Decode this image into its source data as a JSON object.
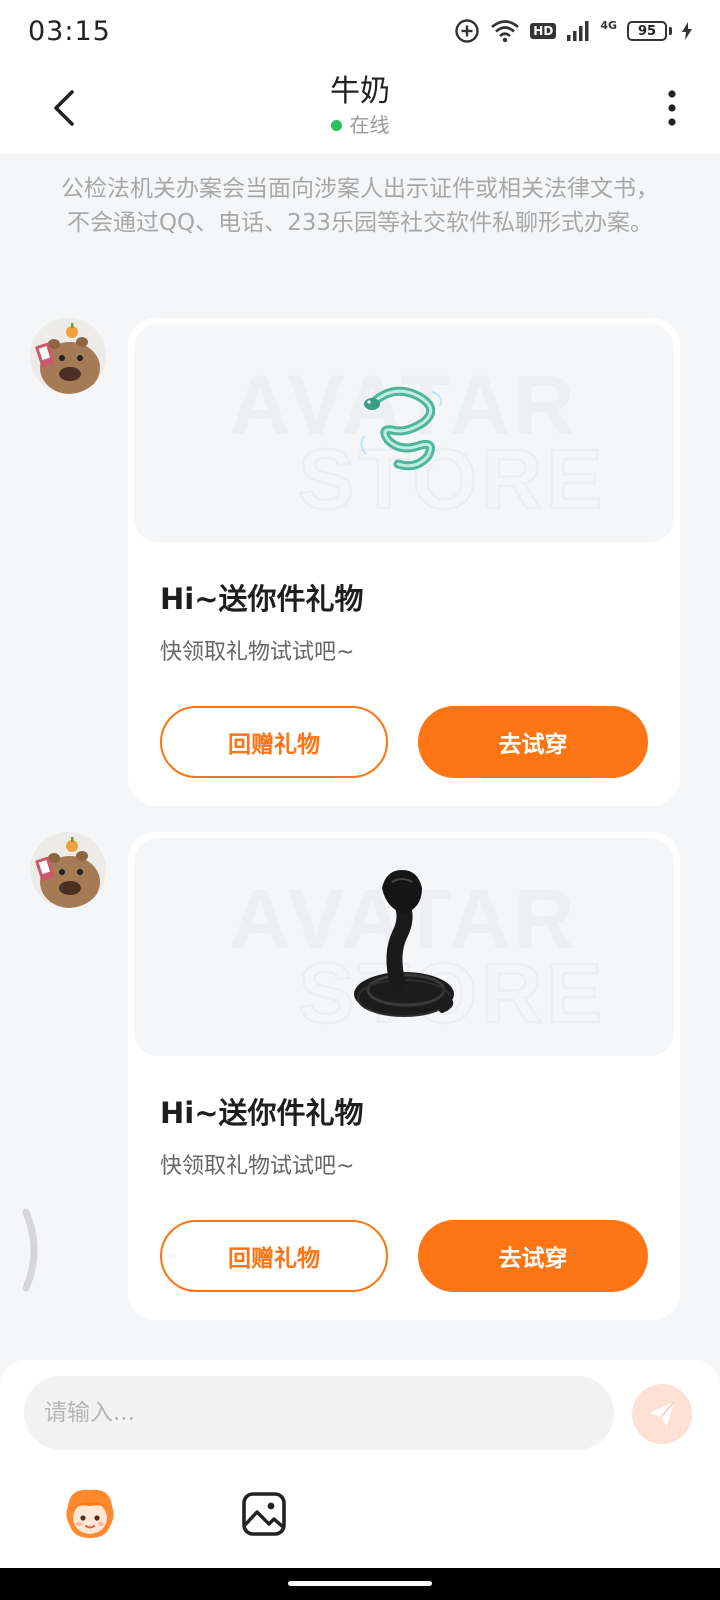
{
  "status_bar": {
    "time": "03:15",
    "hd_label": "HD",
    "network_label": "4G",
    "battery": "95",
    "icons": [
      "add-circle-icon",
      "wifi-icon",
      "hd-icon",
      "signal-icon",
      "battery-icon",
      "charging-icon"
    ]
  },
  "header": {
    "title": "牛奶",
    "status": "在线",
    "back_icon": "chevron-left-icon",
    "more_icon": "more-vertical-icon"
  },
  "notice": "公检法机关办案会当面向涉案人出示证件或相关法律文书，不会通过QQ、电话、233乐园等社交软件私聊形式办案。",
  "messages": [
    {
      "sender_avatar": "capybara-avatar",
      "card": {
        "image": "teal-serpent-gift",
        "title": "Hi~送你件礼物",
        "subtitle": "快领取礼物试试吧~",
        "return_gift_label": "回赠礼物",
        "try_on_label": "去试穿"
      }
    },
    {
      "sender_avatar": "capybara-avatar",
      "card": {
        "image": "black-cobra-gift",
        "title": "Hi~送你件礼物",
        "subtitle": "快领取礼物试试吧~",
        "return_gift_label": "回赠礼物",
        "try_on_label": "去试穿"
      }
    }
  ],
  "input": {
    "placeholder": "请输入...",
    "send_icon": "send-icon"
  },
  "toolbar": {
    "emoji_icon": "avatar-emoji-icon",
    "image_icon": "image-icon"
  },
  "colors": {
    "accent": "#ff7413",
    "online": "#2ac15c",
    "send_bg": "#ffe0d4",
    "background": "#f4f6f8"
  }
}
